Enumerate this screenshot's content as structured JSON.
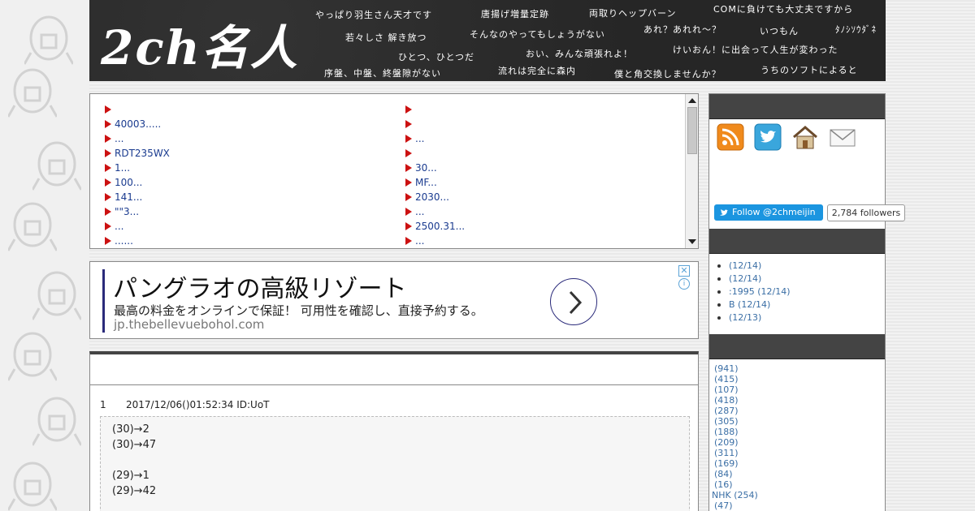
{
  "header": {
    "logo": "2ch名人",
    "taglines": [
      "やっぱり羽生さん天才です",
      "唐揚げ増量定跡",
      "両取りヘップバーン",
      "COMに負けても大丈夫ですから",
      "若々しさ 解き放つ",
      "そんなのやってもしょうがない",
      "あれ？あれれ～？",
      "いつもん",
      "ﾀﾉｼｿｳﾀﾞﾈ",
      "ひとつ、ひとつだ",
      "おい、みんな頑張れよ！",
      "けいおん！に出会って人生が変わった",
      "序盤、中盤、終盤隙がない",
      "流れは完全に森内",
      "僕と角交換しませんか？",
      "うちのソフトによると"
    ]
  },
  "links": {
    "left": [
      "",
      "40003.....",
      "...",
      "RDT235WX",
      "1...",
      "100...",
      "141...",
      "\"\"3...",
      "...",
      "......"
    ],
    "right": [
      "",
      "",
      "...",
      "",
      "30...",
      "MF...",
      "2030...",
      "...",
      "2500.31...",
      "..."
    ]
  },
  "ad": {
    "title": "パングラオの高級リゾート",
    "description": "最高の料金をオンラインで保証！ 可用性を確認し、直接予約する。",
    "url": "jp.thebellevuebohol.com",
    "close": "✕",
    "info": "i"
  },
  "post": {
    "number": "1",
    "meta": "2017/12/06()01:52:34 ID:UoT",
    "lines": [
      "(30)→2",
      "(30)→47",
      "",
      "(29)→1",
      "(29)→42"
    ]
  },
  "sidebar": {
    "icons": [
      "rss-icon",
      "twitter-icon",
      "home-icon",
      "mail-icon"
    ],
    "follow_label": "Follow @2chmeijin",
    "followers": "2,784 followers",
    "recent": [
      "(12/14)",
      "(12/14)",
      ":1995 (12/14)",
      "B (12/14)",
      "(12/13)"
    ],
    "categories": [
      "(941)",
      "(415)",
      "(107)",
      "(418)",
      "(287)",
      "(305)",
      "(188)",
      "(209)",
      "(311)",
      "(169)",
      "(84)",
      "(16)",
      "NHK (254)",
      "(47)"
    ]
  },
  "colors": {
    "header_bg": "#262626",
    "link": "#1a3b8f",
    "arrow": "#cc1111",
    "twitter": "#1b95e0",
    "sidebar_head": "#444444"
  }
}
